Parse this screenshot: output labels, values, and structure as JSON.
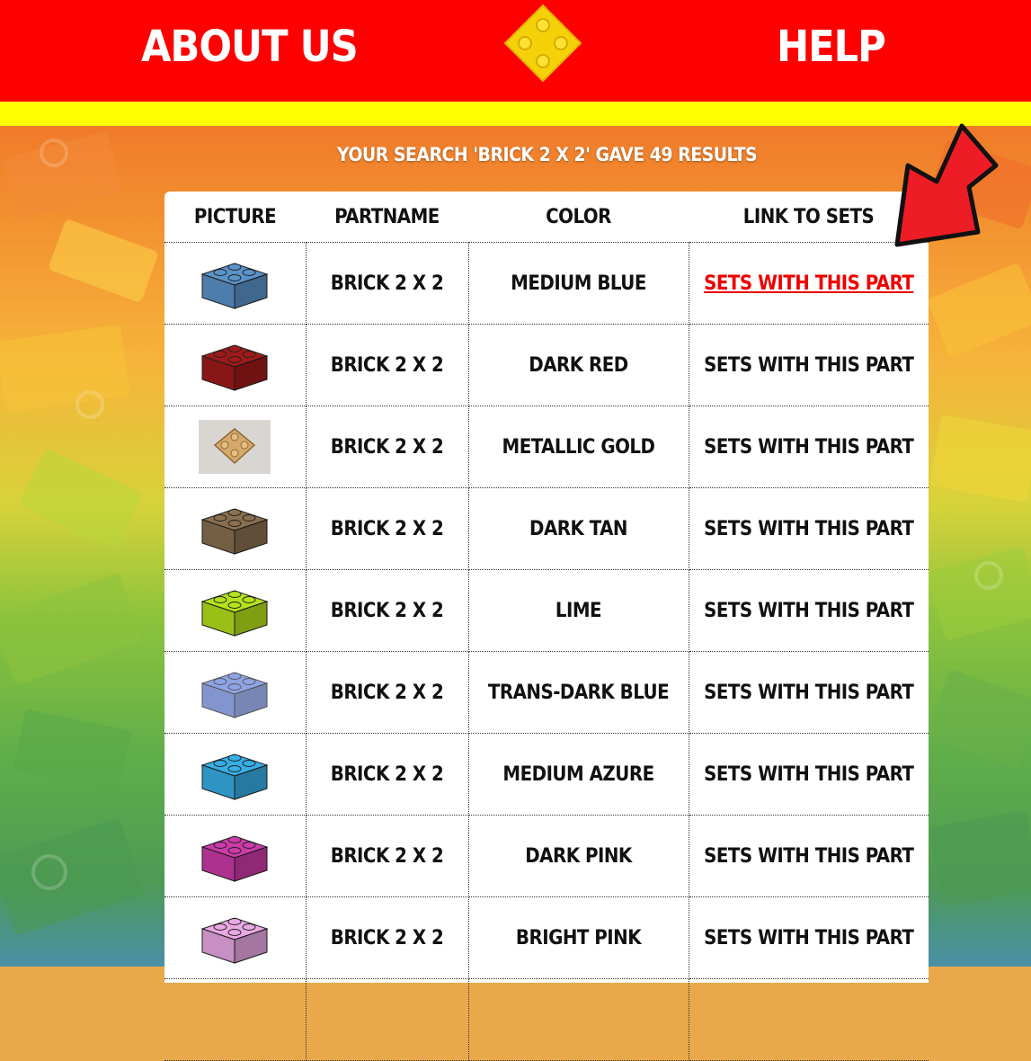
{
  "nav": {
    "about_label": "ABOUT US",
    "help_label": "HELP"
  },
  "results": {
    "title": "YOUR SEARCH 'BRICK 2 X 2' GAVE 49 RESULTS",
    "columns": [
      "PICTURE",
      "PARTNAME",
      "COLOR",
      "LINK TO SETS"
    ],
    "rows": [
      {
        "partname": "BRICK 2 X 2",
        "color": "MEDIUM BLUE",
        "link": "SETS WITH THIS PART",
        "swatch": "#5b93c9",
        "active": true
      },
      {
        "partname": "BRICK 2 X 2",
        "color": "DARK RED",
        "link": "SETS WITH THIS PART",
        "swatch": "#a01a1a"
      },
      {
        "partname": "BRICK 2 X 2",
        "color": "METALLIC GOLD",
        "link": "SETS WITH THIS PART",
        "swatch": "#d6a96a",
        "photo": true
      },
      {
        "partname": "BRICK 2 X 2",
        "color": "DARK TAN",
        "link": "SETS WITH THIS PART",
        "swatch": "#8a7050"
      },
      {
        "partname": "BRICK 2 X 2",
        "color": "LIME",
        "link": "SETS WITH THIS PART",
        "swatch": "#b5e21a"
      },
      {
        "partname": "BRICK 2 X 2",
        "color": "TRANS-DARK BLUE",
        "link": "SETS WITH THIS PART",
        "swatch": "#6a86e0",
        "trans": true
      },
      {
        "partname": "BRICK 2 X 2",
        "color": "MEDIUM AZURE",
        "link": "SETS WITH THIS PART",
        "swatch": "#36aee6"
      },
      {
        "partname": "BRICK 2 X 2",
        "color": "DARK PINK",
        "link": "SETS WITH THIS PART",
        "swatch": "#cc3aa8"
      },
      {
        "partname": "BRICK 2 X 2",
        "color": "BRIGHT PINK",
        "link": "SETS WITH THIS PART",
        "swatch": "#eaa8e4"
      },
      {
        "partname": "",
        "color": "",
        "link": "",
        "swatch": ""
      }
    ]
  },
  "colors": {
    "header_red": "#ff0000",
    "stripe_yellow": "#ffff00",
    "link_active": "#ee0000",
    "arrow_red": "#ee1c25"
  }
}
